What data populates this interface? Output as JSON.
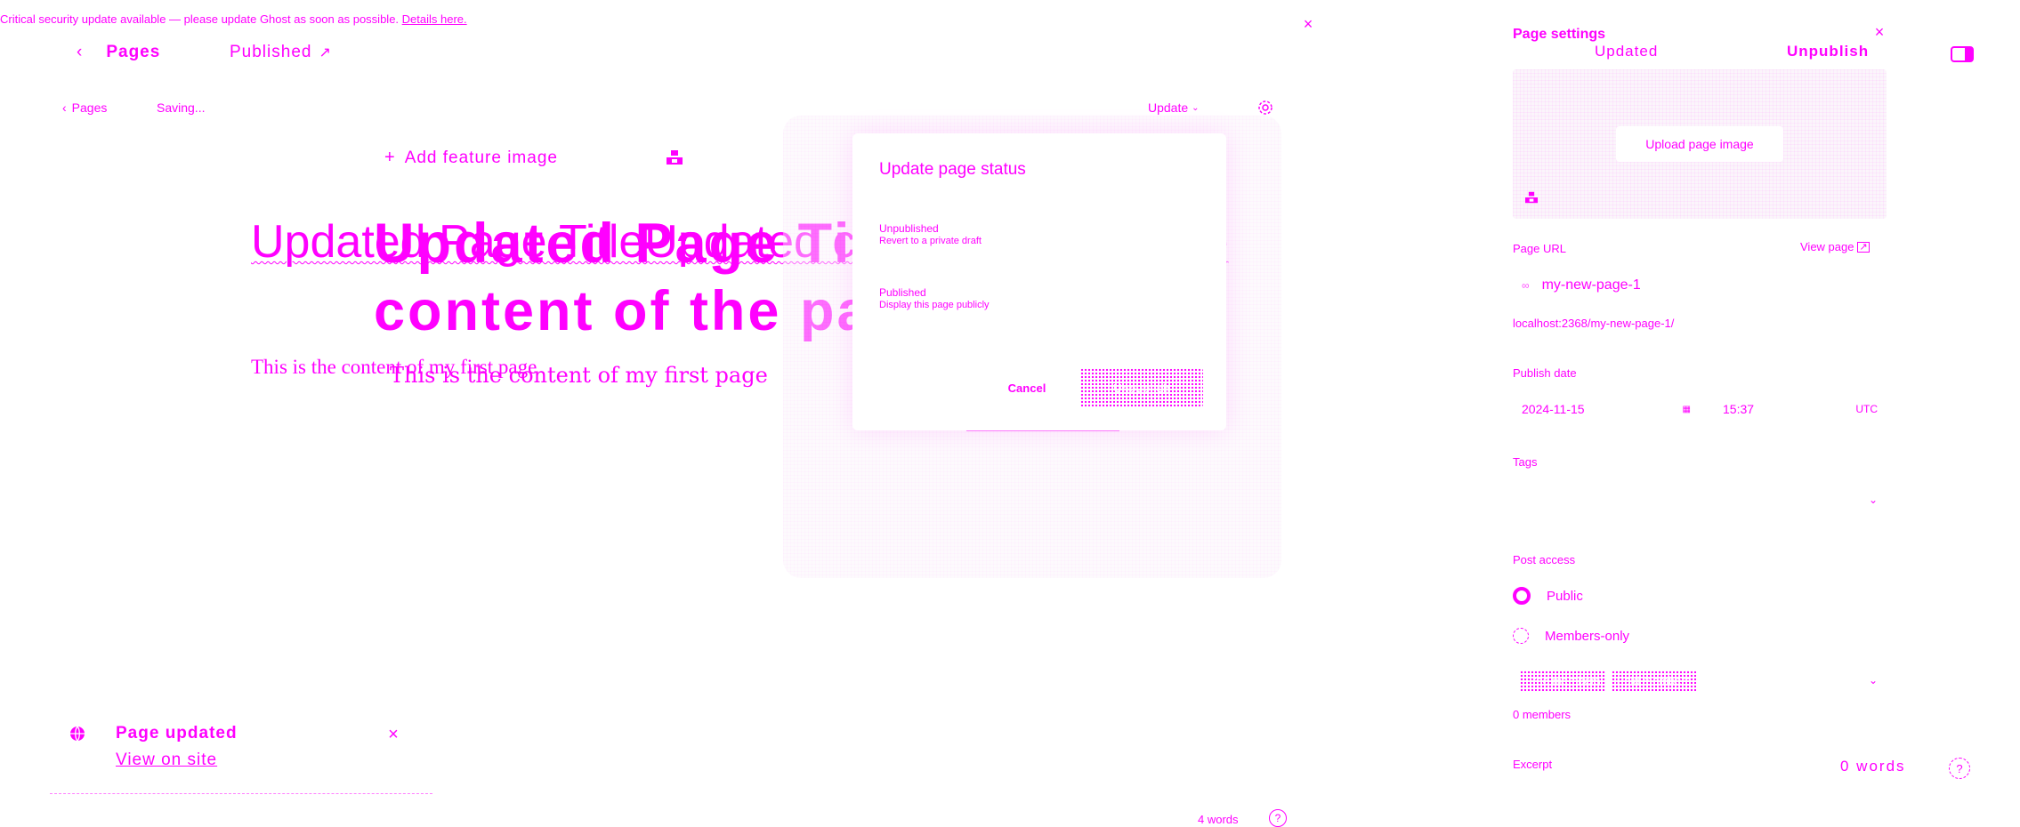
{
  "banner": {
    "text": "Critical security update available — please update Ghost as soon as possible.",
    "link": "Details here."
  },
  "topbar": {
    "back_label": "Pages",
    "status": "Published"
  },
  "toolbar": {
    "pages_label": "Pages",
    "saving_label": "Saving...",
    "update_label": "Update"
  },
  "editor": {
    "add_feature_image": "Add feature image",
    "title_back": "Updated Page TitleUpdated content of the page",
    "title_front_line1": "Updated Page TitleUpdated",
    "title_front_line2": "content of the page",
    "body_back": "This is the content of my first page",
    "body_front": "This is the content of my first page",
    "word_count": "4 words"
  },
  "update_popup": {
    "title": "Update page status",
    "option1_label": "Unpublished",
    "option1_sub": "Revert to a private draft",
    "option2_label": "Published",
    "option2_sub": "Display this page publicly",
    "cancel_label": "Cancel",
    "confirm_label": "Unpublish"
  },
  "toast": {
    "title": "Page updated",
    "link": "View on site"
  },
  "settings": {
    "title": "Page settings",
    "header_status": "Updated",
    "unpublish_label": "Unpublish",
    "upload_image_label": "Upload page image",
    "page_url_label": "Page URL",
    "view_page_label": "View page",
    "slug_value": "my-new-page-1",
    "full_url": "localhost:2368/my-new-page-1/",
    "publish_date_label": "Publish date",
    "date_value": "2024-11-15",
    "time_value": "15:37",
    "timezone": "UTC",
    "tags_label": "Tags",
    "post_access_label": "Post access",
    "access_public": "Public",
    "access_members": "Members-only",
    "tier1": "Free members",
    "tier2": "Paid members",
    "members_count": "0 members",
    "excerpt_label": "Excerpt",
    "excerpt_words": "0 words"
  },
  "colors": {
    "accent": "#ff00ff",
    "background": "#ffffff"
  }
}
